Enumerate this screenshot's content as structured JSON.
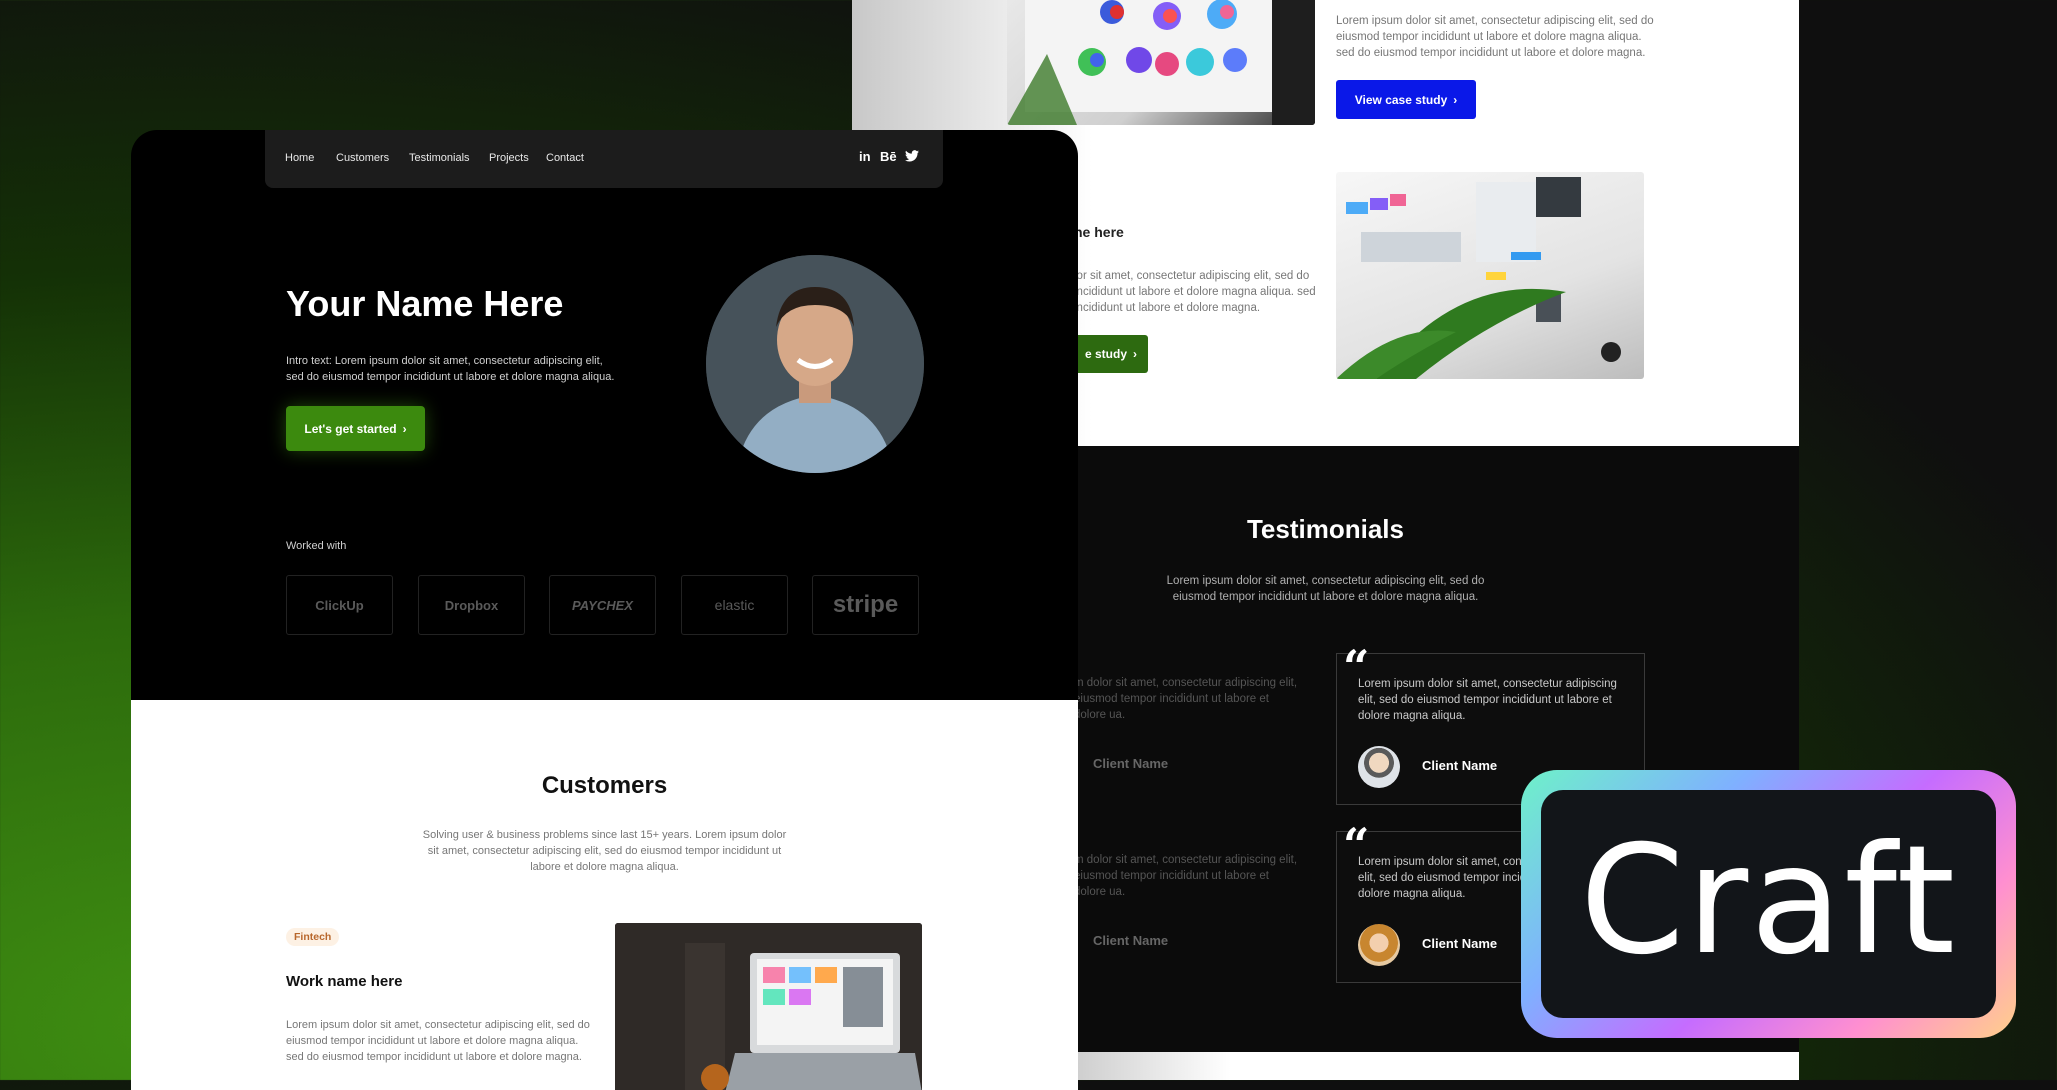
{
  "back_page": {
    "case1": {
      "text": "Lorem ipsum dolor sit amet, consectetur adipiscing elit, sed do eiusmod tempor incididunt ut labore et dolore magna aliqua. sed do eiusmod tempor incididunt ut labore et dolore magna.",
      "button": "View case study"
    },
    "case2": {
      "title_partial": "ne here",
      "text_partial": "lor sit amet, consectetur adipiscing elit, sed do incididunt ut labore et dolore magna aliqua. sed incididunt ut labore et dolore magna.",
      "button_partial": "e study"
    },
    "testimonials": {
      "title": "Testimonials",
      "subtitle": "Lorem ipsum dolor sit amet, consectetur adipiscing elit, sed do eiusmod tempor incididunt ut labore et dolore magna aliqua.",
      "quote": "Lorem ipsum dolor sit amet, consectetur adipiscing elit, sed do eiusmod tempor incididunt ut labore et dolore magna aliqua.",
      "ghost_text": "m dolor sit amet, consectetur adipiscing elit, eiusmod tempor incididunt ut labore et dolore ua.",
      "client_name": "Client Name"
    }
  },
  "front_page": {
    "nav": {
      "items": [
        "Home",
        "Customers",
        "Testimonials",
        "Projects",
        "Contact"
      ],
      "social": [
        "in",
        "Bē",
        "twitter-icon"
      ]
    },
    "hero": {
      "name": "Your Name Here",
      "intro": "Intro text: Lorem ipsum dolor sit amet, consectetur adipiscing elit, sed do eiusmod tempor incididunt ut labore et dolore magna aliqua.",
      "cta": "Let's get started"
    },
    "worked_with": {
      "label": "Worked with",
      "logos": [
        "ClickUp",
        "Dropbox",
        "PAYCHEX",
        "elastic",
        "stripe"
      ]
    },
    "customers": {
      "title": "Customers",
      "subtitle": "Solving user & business problems since last 15+ years. Lorem ipsum dolor sit amet, consectetur adipiscing elit, sed do eiusmod tempor incididunt ut labore et dolore magna aliqua.",
      "tag": "Fintech",
      "work_title": "Work name here",
      "work_text": "Lorem ipsum dolor sit amet, consectetur adipiscing elit, sed do eiusmod tempor incididunt ut labore et dolore magna aliqua. sed do eiusmod tempor incididunt ut labore et dolore magna."
    }
  },
  "badge": {
    "text": "Craft"
  },
  "colors": {
    "accent_green": "#3c8a0e",
    "accent_blue": "#0a18e8"
  }
}
